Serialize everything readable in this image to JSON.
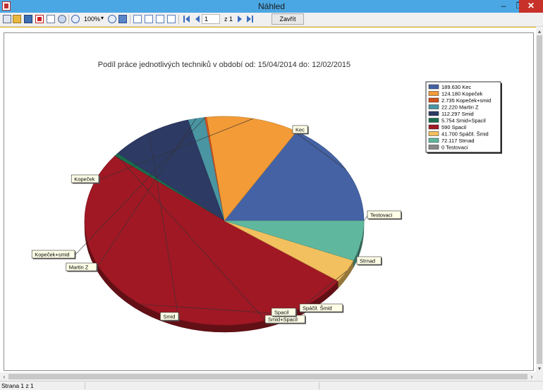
{
  "window": {
    "title": "Náhled",
    "min": "–",
    "max": "❐",
    "close": "✕"
  },
  "toolbar": {
    "zoom": "100%",
    "page_current": "1",
    "page_total": "z 1",
    "close_label": "Zavřít",
    "icons": [
      "printer-icon",
      "open-icon",
      "save-icon",
      "pdf-icon",
      "email-icon",
      "find-icon",
      "zoom-in-icon",
      "zoom-out-icon",
      "page-width-icon",
      "one-page-icon",
      "two-pages-icon",
      "page-setup-icon",
      "edit-icon",
      "first-page-icon",
      "prev-page-icon",
      "next-page-icon",
      "last-page-icon"
    ]
  },
  "report": {
    "title": "Podíl práce jednotlivých techniků v období od: 15/04/2014 do: 12/02/2015"
  },
  "chart_data": {
    "type": "pie",
    "title": "Podíl práce jednotlivých techniků v období od: 15/04/2014 do: 12/02/2015",
    "slices": [
      {
        "name": "Kec",
        "value": 189.63,
        "label": "189.630 Kec",
        "color": "#4462a4"
      },
      {
        "name": "Kopeček",
        "value": 124.18,
        "label": "124.180 Kopeček",
        "color": "#f29b37"
      },
      {
        "name": "Kopeček+smid",
        "value": 2.735,
        "label": "2.735 Kopeček+smid",
        "color": "#d2521d"
      },
      {
        "name": "Martin Z",
        "value": 22.22,
        "label": "22.220 Martin Z",
        "color": "#4a95a2"
      },
      {
        "name": "Smid",
        "value": 112.297,
        "label": "112.297 Smid",
        "color": "#2d3a64"
      },
      {
        "name": "Smid+Spacil",
        "value": 5.754,
        "label": "5.754 Smid+Spacil",
        "color": "#1a6e50"
      },
      {
        "name": "Spacil",
        "value": 590,
        "label": "590 Spacil",
        "color": "#a01824"
      },
      {
        "name": "Spáčil. Šmid",
        "value": 41.7,
        "label": "41.700 Spáčil. Šmid",
        "color": "#f2c05e"
      },
      {
        "name": "Strnad",
        "value": 72.117,
        "label": "72.117 Strnad",
        "color": "#5fb89e"
      },
      {
        "name": "Testovaci",
        "value": 0,
        "label": "0 Testovaci",
        "color": "#888888"
      }
    ],
    "callouts": [
      "Kec",
      "Kopeček",
      "Kopeček+smid",
      "Martin Z",
      "Smid",
      "Smid+Spacil",
      "Spacil",
      "Spáčil. Šmid",
      "Strnad",
      "Testovaci"
    ],
    "legend_position": "top-right",
    "style": "3d-pie"
  },
  "status": {
    "text": "Strana 1 z 1"
  }
}
